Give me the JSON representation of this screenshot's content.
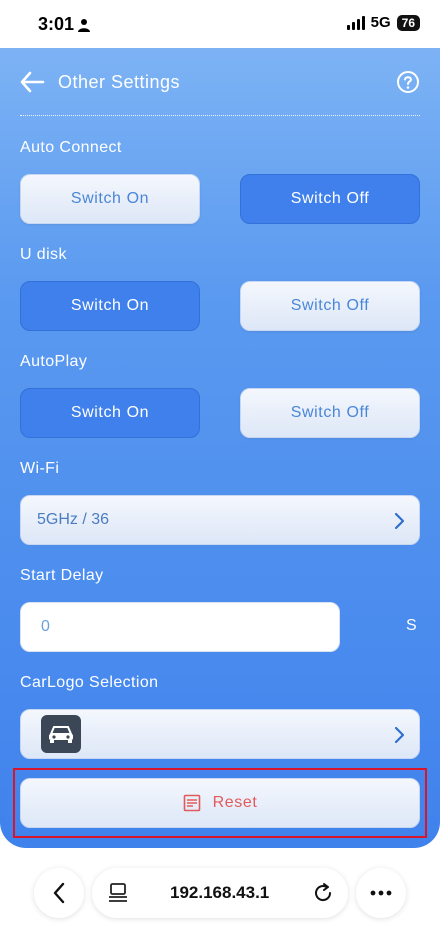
{
  "status_bar": {
    "time": "3:01",
    "network": "5G",
    "battery": "76"
  },
  "header": {
    "title": "Other Settings"
  },
  "auto_connect": {
    "label": "Auto Connect",
    "on_label": "Switch On",
    "off_label": "Switch Off",
    "selected": "off"
  },
  "u_disk": {
    "label": "U disk",
    "on_label": "Switch On",
    "off_label": "Switch Off",
    "selected": "on"
  },
  "autoplay": {
    "label": "AutoPlay",
    "on_label": "Switch On",
    "off_label": "Switch Off",
    "selected": "on"
  },
  "wifi": {
    "label": "Wi-Fi",
    "value": "5GHz / 36"
  },
  "start_delay": {
    "label": "Start Delay",
    "value": "0",
    "unit": "S"
  },
  "car_logo": {
    "label": "CarLogo Selection"
  },
  "reset": {
    "label": "Reset"
  },
  "browser": {
    "url": "192.168.43.1"
  },
  "colors": {
    "accent": "#3f80ec",
    "highlight_frame": "#d8152a",
    "reset_text": "#e25a5a"
  }
}
